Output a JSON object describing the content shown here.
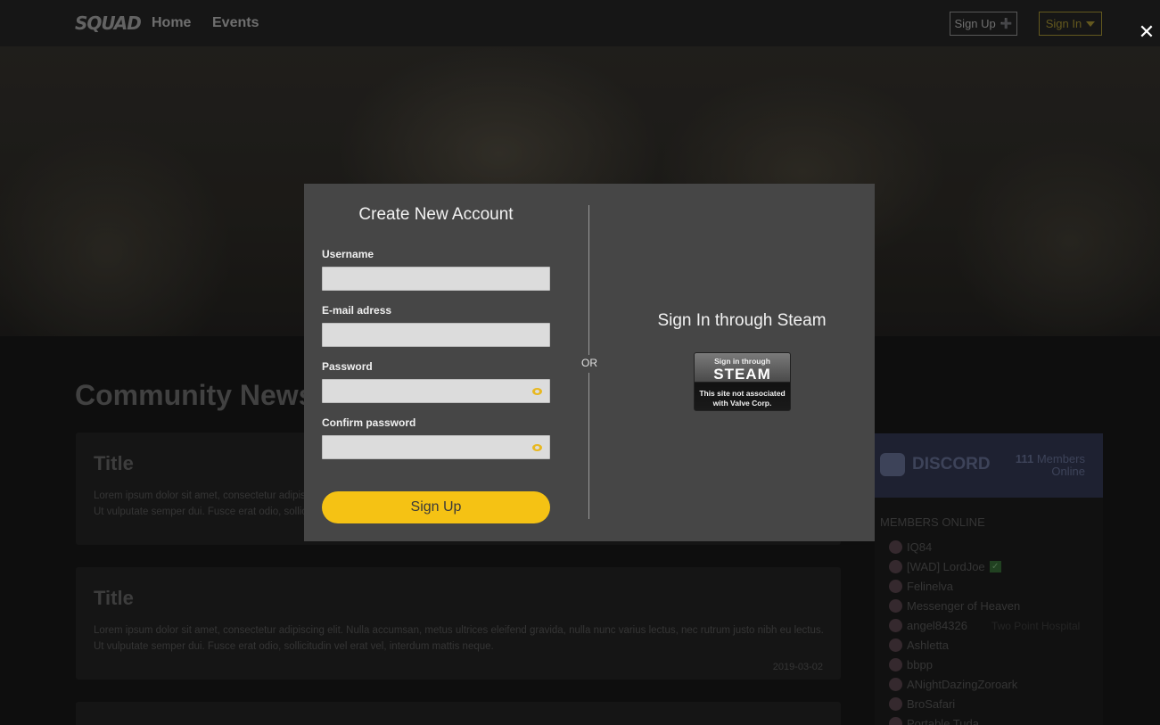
{
  "nav": {
    "logo": "SQUAD",
    "links": [
      "Home",
      "Events"
    ],
    "signup_label": "Sign Up",
    "signin_label": "Sign In"
  },
  "main": {
    "section_title": "Community News",
    "cards": [
      {
        "title": "Title",
        "text": "Lorem ipsum dolor sit amet, consectetur adipiscing elit. Nulla accumsan, metus ultrices eleifend gravida, nulla nunc varius lectus, nec rutrum justo nibh eu lectus. Ut vulputate semper dui. Fusce erat odio, sollicitudin vel erat vel, interdum mattis neque.",
        "date": ""
      },
      {
        "title": "Title",
        "text": "Lorem ipsum dolor sit amet, consectetur adipiscing elit. Nulla accumsan, metus ultrices eleifend gravida, nulla nunc varius lectus, nec rutrum justo nibh eu lectus. Ut vulputate semper dui. Fusce erat odio, sollicitudin vel erat vel, interdum mattis neque.",
        "date": "2019-03-02"
      }
    ]
  },
  "discord": {
    "brand": "DISCORD",
    "count": "111",
    "count_label_1": "Members",
    "count_label_2": "Online",
    "members_heading": "MEMBERS ONLINE",
    "members": [
      "IQ84",
      "[WAD] LordJoe",
      "Felinelva",
      "Messenger of Heaven",
      "angel84326",
      "Ashletta",
      "bbpp",
      "ANightDazingZoroark",
      "BroSafari",
      "Portable Tuda"
    ],
    "member_sub": "Two Point Hospital"
  },
  "modal": {
    "title": "Create New Account",
    "username_label": "Username",
    "email_label": "E-mail adress",
    "password_label": "Password",
    "confirm_label": "Confirm password",
    "signup_button": "Sign Up",
    "or": "OR",
    "steam_title": "Sign In through Steam",
    "steam_small": "Sign in through",
    "steam_big": "STEAM",
    "steam_note_1": "This site not associated",
    "steam_note_2": "with Valve Corp."
  },
  "colors": {
    "modal_bg": "#464646",
    "accent": "#f5c214",
    "field_bg": "#dcdcdc",
    "discord_bg": "#2a2f45"
  }
}
